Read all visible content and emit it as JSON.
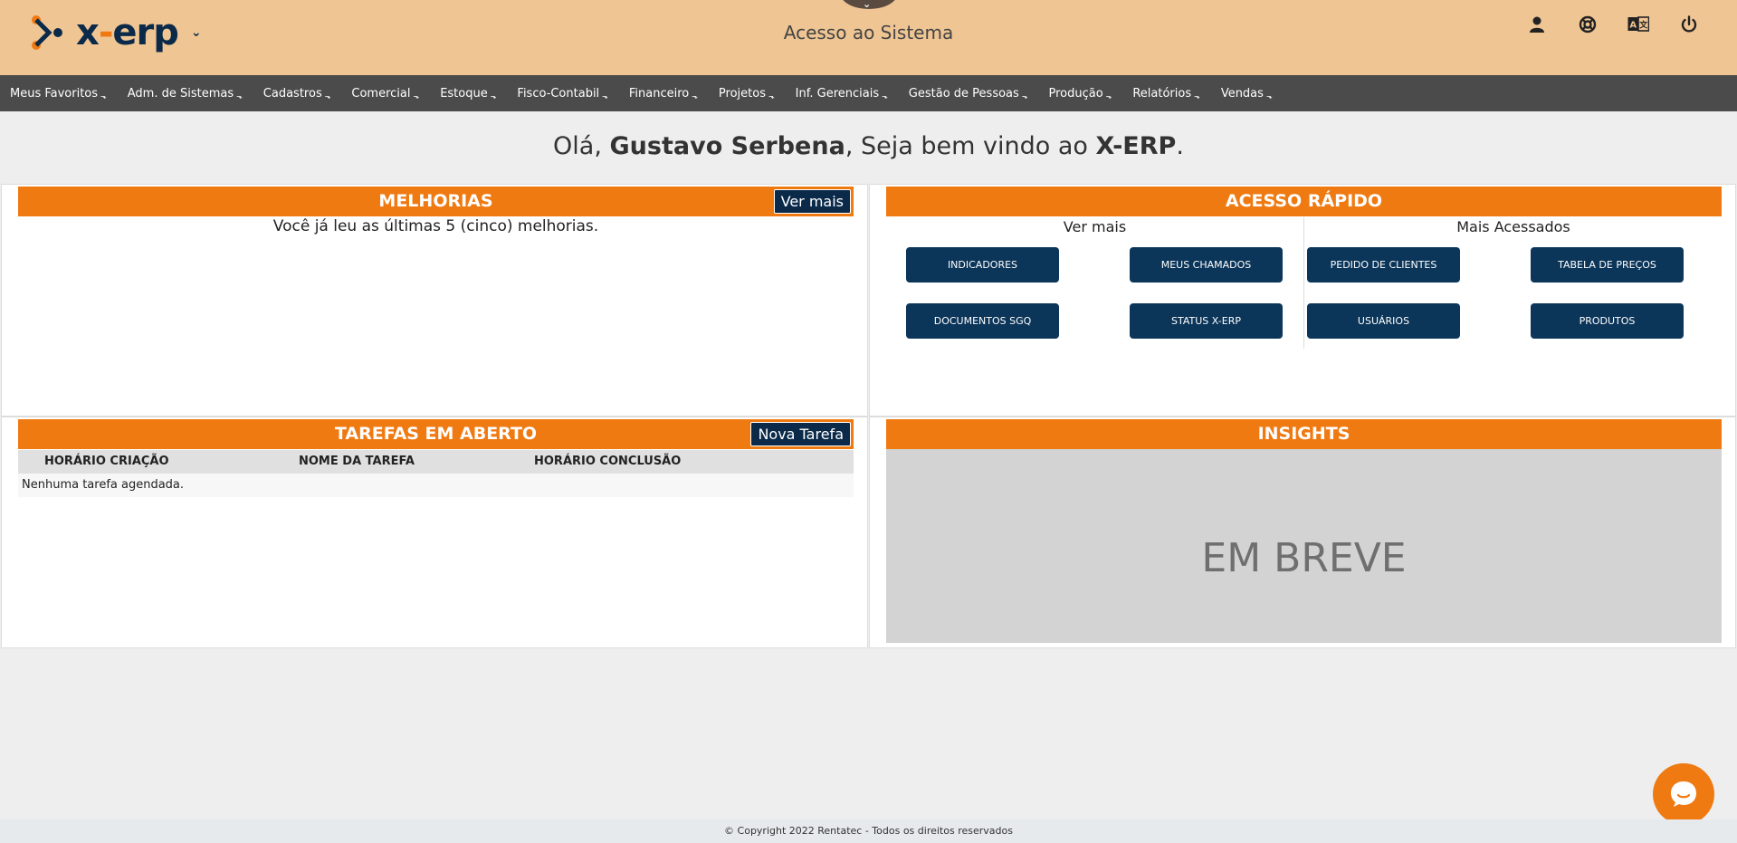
{
  "header": {
    "logo_text_left": "x",
    "logo_text_dash": "-",
    "logo_text_right": "erp",
    "page_heading": "Acesso ao Sistema",
    "icons": [
      "user-icon",
      "support-lifebuoy-icon",
      "translate-icon",
      "power-icon"
    ]
  },
  "nav": {
    "items": [
      "Meus Favoritos",
      "Adm. de Sistemas",
      "Cadastros",
      "Comercial",
      "Estoque",
      "Fisco-Contabil",
      "Financeiro",
      "Projetos",
      "Inf. Gerenciais",
      "Gestão de Pessoas",
      "Produção",
      "Relatórios",
      "Vendas"
    ]
  },
  "greeting": {
    "prefix": "Olá, ",
    "user": "Gustavo Serbena",
    "middle": ", Seja bem vindo ao ",
    "app": "X-ERP",
    "suffix": "."
  },
  "melhorias": {
    "title": "MELHORIAS",
    "button": "Ver mais",
    "message": "Você já leu as últimas 5 (cinco) melhorias."
  },
  "acesso_rapido": {
    "title": "ACESSO RÁPIDO",
    "left_title": "Ver mais",
    "right_title": "Mais Acessados",
    "left_buttons": [
      "INDICADORES",
      "MEUS CHAMADOS",
      "DOCUMENTOS SGQ",
      "STATUS X-ERP"
    ],
    "right_buttons": [
      "PEDIDO DE CLIENTES",
      "TABELA DE PREÇOS",
      "USUÁRIOS",
      "PRODUTOS"
    ]
  },
  "tarefas": {
    "title": "TAREFAS EM ABERTO",
    "button": "Nova Tarefa",
    "columns": [
      "HORÁRIO CRIAÇÃO",
      "NOME DA TAREFA",
      "HORÁRIO CONCLUSÃO"
    ],
    "empty_message": "Nenhuma tarefa agendada."
  },
  "insights": {
    "title": "INSIGHTS",
    "placeholder": "EM BREVE"
  },
  "footer": {
    "text": "© Copyright 2022 Rentatec - Todos os direitos reservados"
  },
  "colors": {
    "header_bg": "#efc593",
    "nav_bg": "#4b4b4b",
    "accent_orange": "#f07a12",
    "navy": "#0b2a4a"
  }
}
